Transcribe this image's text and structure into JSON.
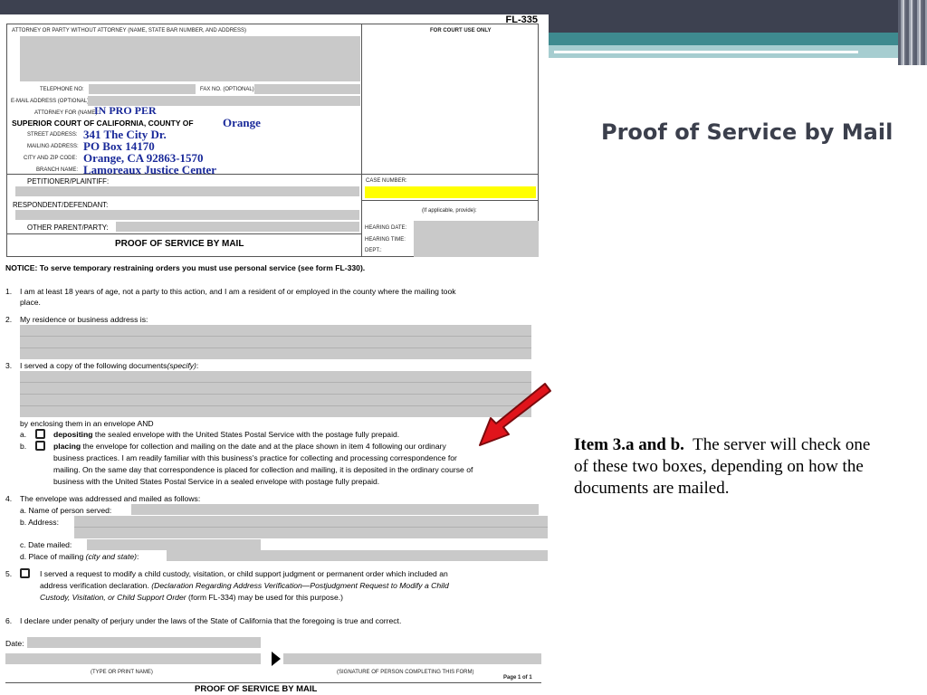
{
  "slide": {
    "title": "Proof of Service by Mail",
    "note_bold": "Item 3.a and b.",
    "note_text": "The server will check one of these two boxes, depending on how the documents are mailed.",
    "accent_color": "#3e8a8f",
    "arrow_color": "#e0141b"
  },
  "form": {
    "form_number": "FL-335",
    "attorney_label": "ATTORNEY OR PARTY WITHOUT ATTORNEY (Name, State Bar number, and address)",
    "court_use_label": "FOR COURT USE ONLY",
    "telephone_label": "TELEPHONE NO:",
    "fax_label": "FAX NO. (Optional):",
    "email_label": "E-MAIL ADDRESS (Optional):",
    "attorney_for_label": "ATTORNEY FOR (Name):",
    "attorney_for_value": "IN PRO PER",
    "court_label": "SUPERIOR COURT OF CALIFORNIA, COUNTY OF",
    "county_value": "Orange",
    "street_label": "STREET ADDRESS:",
    "street_value": "341 The City Dr.",
    "mailing_label": "MAILING ADDRESS:",
    "mailing_value": "PO Box 14170",
    "city_label": "CITY AND ZIP CODE:",
    "city_value": "Orange, CA  92863-1570",
    "branch_label": "BRANCH NAME:",
    "branch_value": "Lamoreaux Justice Center",
    "petitioner_label": "PETITIONER/PLAINTIFF:",
    "respondent_label": "RESPONDENT/DEFENDANT:",
    "other_label": "OTHER PARENT/PARTY:",
    "case_number_label": "CASE NUMBER:",
    "if_applicable": "(If applicable, provide):",
    "hearing_date_label": "HEARING DATE:",
    "hearing_time_label": "HEARING TIME:",
    "dept_label": "DEPT.:",
    "doc_title": "PROOF OF SERVICE BY MAIL",
    "notice": "NOTICE: To serve temporary restraining orders you must use personal service (see form FL-330).",
    "item1_num": "1.",
    "item1_line1": "I am at least 18 years of age, not a party to this action, and I am a resident of or employed in the county where the mailing took",
    "item1_line2": "place.",
    "item2_num": "2.",
    "item2": "My residence or business address is:",
    "item3_num": "3.",
    "item3_a": "I served a copy of the following documents",
    "item3_b": "(specify)",
    "item3_c": ":",
    "enclosing": "by enclosing them in an envelope AND",
    "a_letter": "a.",
    "a_bold": "depositing",
    "a_rest": "the sealed envelope with the United States Postal Service with the postage fully prepaid.",
    "b_letter": "b.",
    "b_bold": "placing",
    "b_line1": "the envelope for collection and mailing on the date and at the place shown in item 4 following our ordinary",
    "b_line2": "business practices. I am readily familiar with this business's practice for collecting and processing correspondence for",
    "b_line3": "mailing. On the same day that correspondence is placed for collection and mailing, it is deposited in the ordinary course of",
    "b_line4": "business with the United States Postal Service in a sealed envelope with postage fully prepaid.",
    "item4_num": "4.",
    "item4": "The envelope was addressed and mailed as follows:",
    "item4a": "a.   Name of person served:",
    "item4b": "b.   Address:",
    "item4c": "c.   Date mailed:",
    "item4d_a": "d.   Place of mailing",
    "item4d_b": "(city and state)",
    "item4d_c": ":",
    "item5_num": "5.",
    "item5_line1": "I served a request to modify a child custody, visitation, or child support judgment or permanent order which included an",
    "item5_line2a": "address verification declaration.",
    "item5_line2b": "(Declaration Regarding Address Verification—Postjudgment Request to Modify a Child",
    "item5_line3a": "Custody, Visitation, or Child Support Order",
    "item5_line3b": "(form FL-334) may be used for this purpose.)",
    "item6_num": "6.",
    "item6": "I declare under penalty of perjury under the laws of the State of California that the foregoing is true and correct.",
    "date_label": "Date:",
    "type_name_label": "(TYPE OR PRINT NAME)",
    "signature_label": "(SIGNATURE OF PERSON COMPLETING THIS FORM)",
    "page_label": "Page 1 of 1",
    "footer_title": "PROOF OF SERVICE BY MAIL"
  }
}
